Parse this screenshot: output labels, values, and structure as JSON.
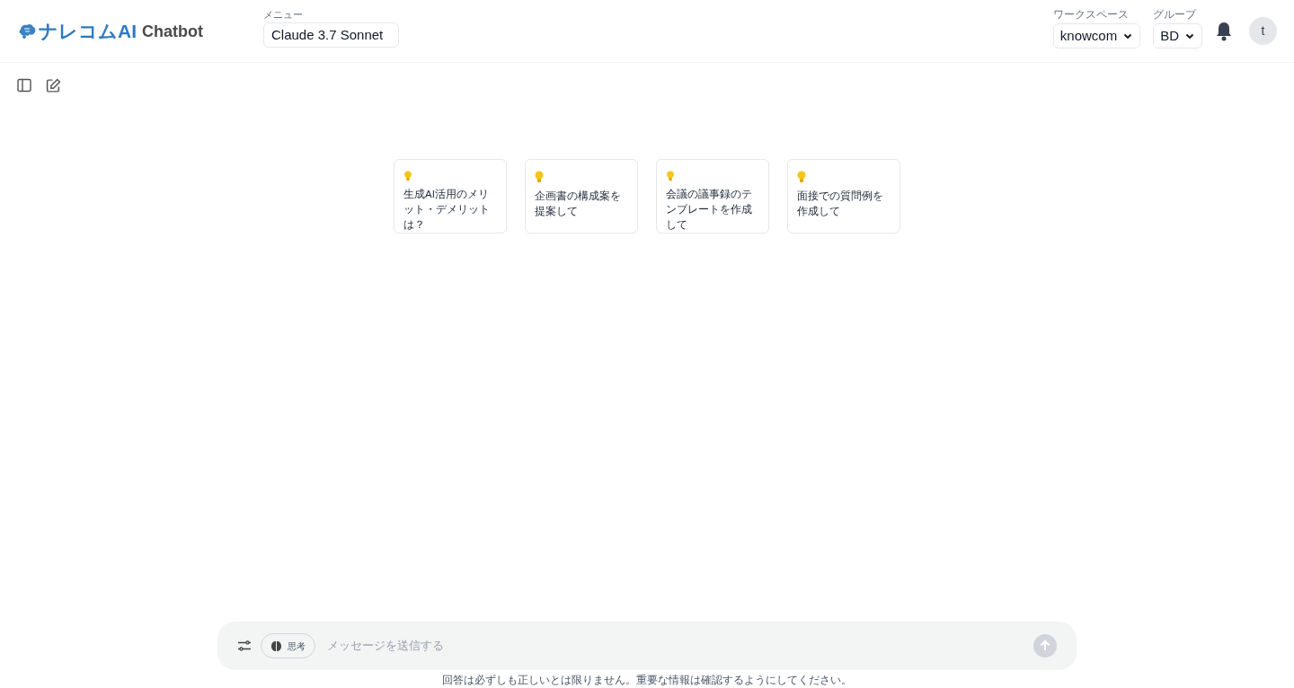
{
  "header": {
    "logo_text": "ナレコムAI",
    "logo_suffix": "Chatbot",
    "model_label": "メニュー",
    "model_value": "Claude 3.7 Sonnet",
    "workspace_label": "ワークスペース",
    "workspace_value": "knowcom",
    "group_label": "グループ",
    "group_value": "BD",
    "avatar_initial": "t"
  },
  "suggestions": [
    {
      "text": "生成AI活用のメリット・デメリットは？"
    },
    {
      "text": "企画書の構成案を提案して"
    },
    {
      "text": "会議の議事録のテンプレートを作成して"
    },
    {
      "text": "面接での質問例を作成して"
    }
  ],
  "composer": {
    "thinking_label": "思考",
    "placeholder": "メッセージを送信する",
    "disclaimer": "回答は必ずしも正しいとは限りません。重要な情報は確認するようにしてください。"
  }
}
